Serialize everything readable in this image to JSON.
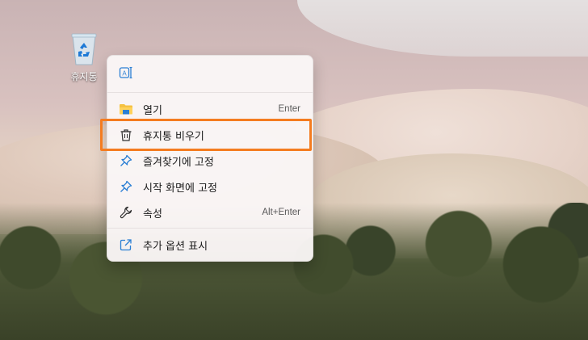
{
  "desktop": {
    "icons": [
      {
        "label": "휴지통",
        "icon": "recycle-bin-icon"
      }
    ]
  },
  "context_menu": {
    "top_action_icon": "rename-icon",
    "items": [
      {
        "label": "열기",
        "shortcut": "Enter",
        "icon": "folder-icon"
      },
      {
        "label": "휴지통 비우기",
        "shortcut": "",
        "icon": "trash-icon",
        "highlighted": true
      },
      {
        "label": "즐겨찾기에 고정",
        "shortcut": "",
        "icon": "pin-icon"
      },
      {
        "label": "시작 화면에 고정",
        "shortcut": "",
        "icon": "pin-icon"
      },
      {
        "label": "속성",
        "shortcut": "Alt+Enter",
        "icon": "wrench-icon"
      }
    ],
    "more_options": {
      "label": "추가 옵션 표시",
      "icon": "share-out-icon"
    }
  },
  "colors": {
    "highlight_border": "#f47c20",
    "pin_blue": "#2b7fd4",
    "folder_yellow": "#f5c242"
  }
}
